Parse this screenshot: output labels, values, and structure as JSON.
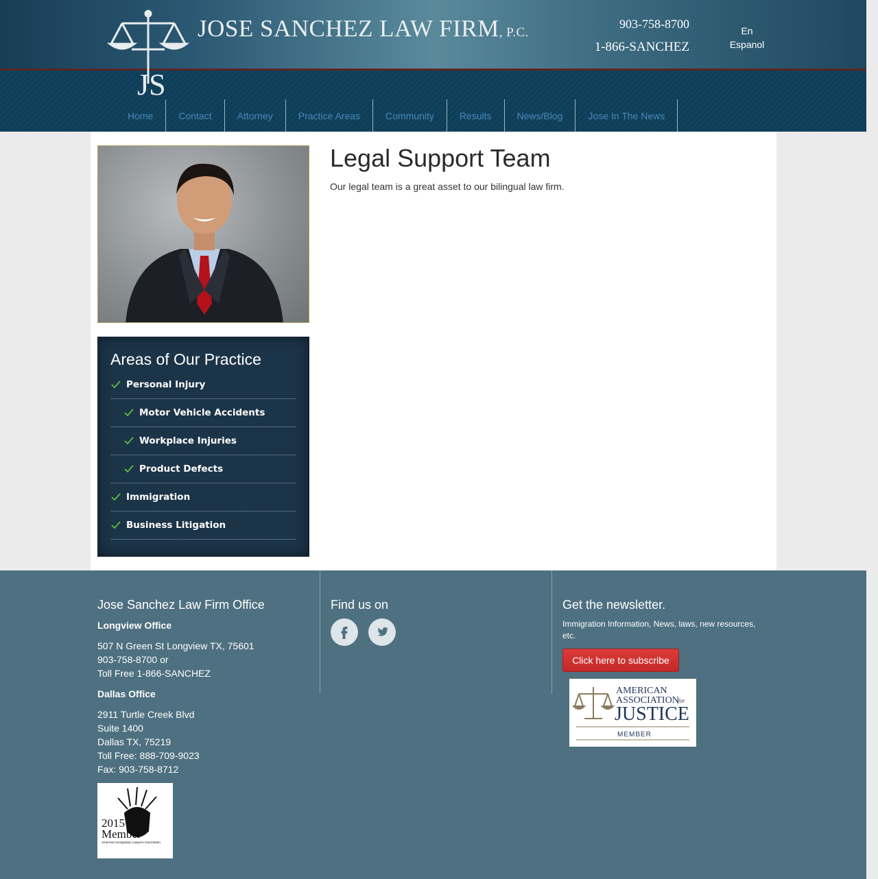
{
  "header": {
    "firm_name": "JOSE SANCHEZ LAW FIRM",
    "firm_suffix": "P.C.",
    "phone_local": "903-758-8700",
    "phone_tollfree": "1-866-SANCHEZ",
    "lang_en": "En",
    "lang_es": "Espanol",
    "logo_letters": "JS"
  },
  "nav": {
    "items": [
      {
        "label": "Home"
      },
      {
        "label": "Contact"
      },
      {
        "label": "Attorney"
      },
      {
        "label": "Practice Areas"
      },
      {
        "label": "Community"
      },
      {
        "label": "Results"
      },
      {
        "label": "News/Blog"
      },
      {
        "label": "Jose In The News"
      }
    ]
  },
  "main": {
    "title": "Legal Support Team",
    "intro": "Our legal team is a great asset to our bilingual law firm."
  },
  "sidebar": {
    "practice_title": "Areas of Our Practice",
    "practice_items": [
      {
        "label": "Personal Injury"
      },
      {
        "label": "Motor Vehicle Accidents"
      },
      {
        "label": "Workplace Injuries"
      },
      {
        "label": "Product Defects"
      },
      {
        "label": "Immigration"
      },
      {
        "label": "Business Litigation"
      }
    ]
  },
  "footer": {
    "office_heading": "Jose Sanchez Law Firm Office",
    "longview_label": "Longview Office",
    "longview_lines": [
      "507 N Green St Longview TX, 75601",
      "903-758-8700 or",
      "Toll Free 1-866-SANCHEZ"
    ],
    "dallas_label": "Dallas Office",
    "dallas_lines": [
      "2911 Turtle Creek Blvd",
      "Suite 1400",
      "Dallas TX, 75219",
      "Toll Free: 888-709-9023",
      "Fax: 903-758-8712"
    ],
    "find_us_heading": "Find us on",
    "newsletter_heading": "Get the newsletter.",
    "newsletter_desc": "Immigration Information, News, laws, new resources, etc.",
    "subscribe_label": "Click here to subscribe",
    "aaj_line1": "AMERICAN",
    "aaj_line2": "ASSOCIATION",
    "aaj_for": "for",
    "aaj_line3": "JUSTICE",
    "aaj_member": "MEMBER",
    "aila_year": "2015",
    "aila_member": "Member",
    "aila_org": "American Immigration Lawyers Association"
  },
  "colors": {
    "nav_text": "#4a88b5",
    "footer_bg": "#4e7080",
    "subscribe_red": "#d13532",
    "check_green": "#5fbf47"
  }
}
